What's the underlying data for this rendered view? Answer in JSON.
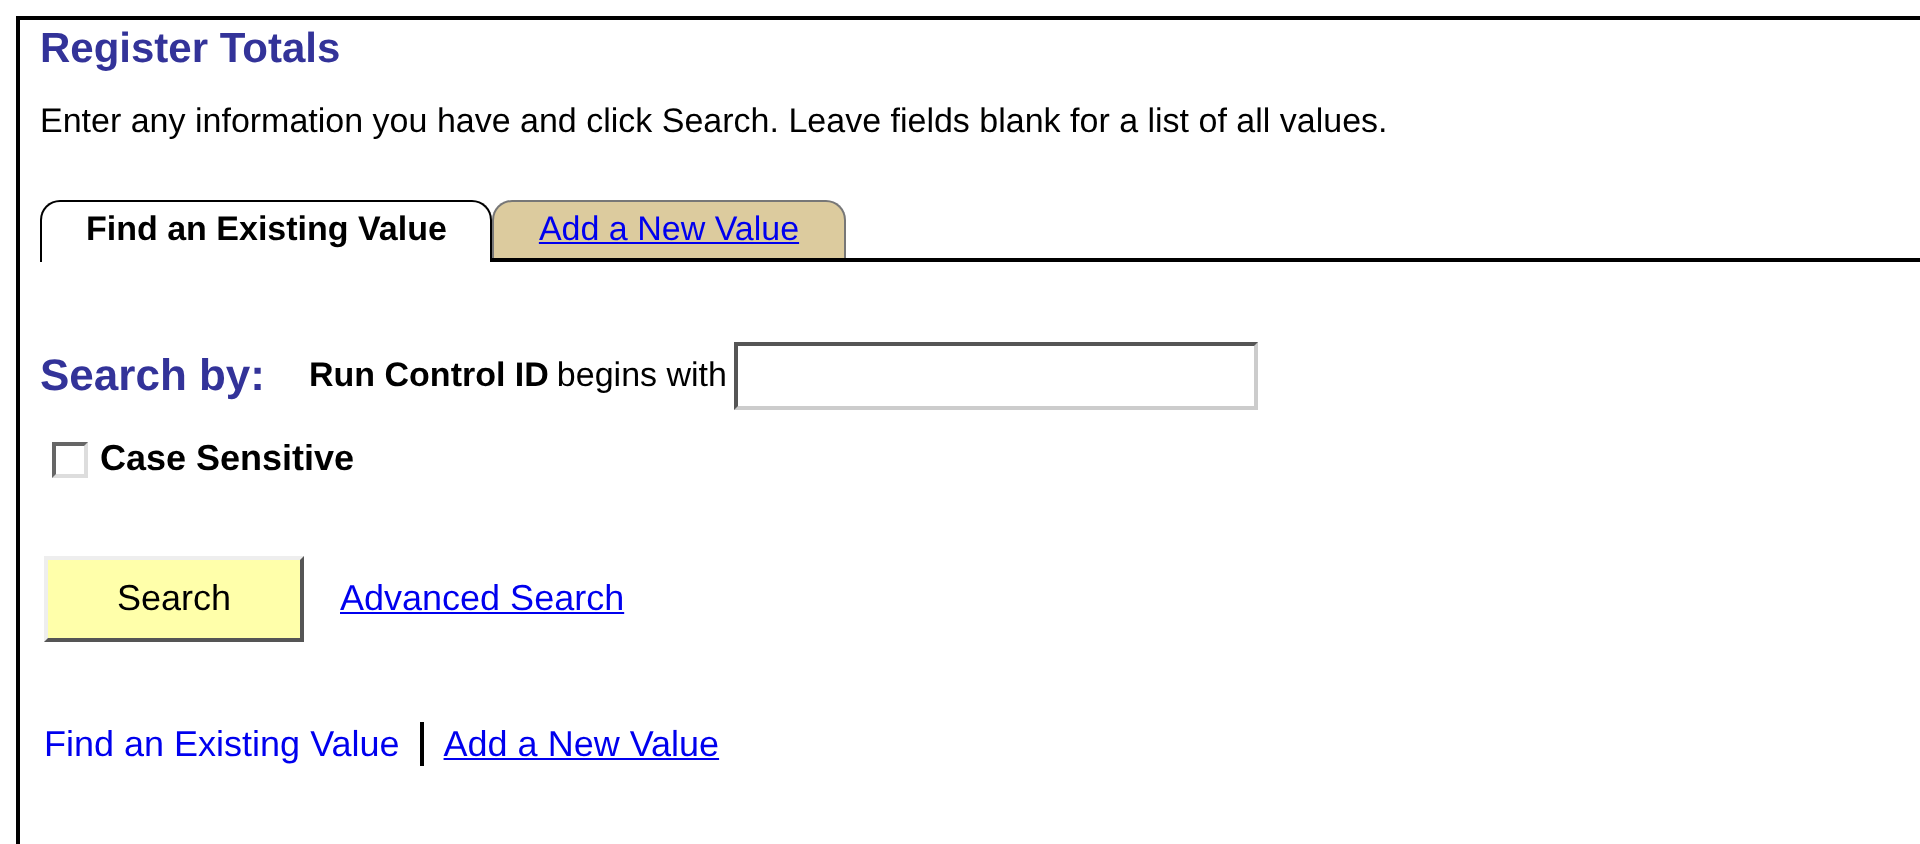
{
  "page": {
    "title": "Register Totals",
    "instructions": "Enter any information you have and click Search. Leave fields blank for a list of all values."
  },
  "tabs": [
    {
      "label": "Find an Existing Value",
      "selected": true
    },
    {
      "label": "Add a New Value",
      "selected": false
    }
  ],
  "search": {
    "label": "Search by:",
    "field_label": "Run Control ID",
    "operator": "begins with"
  },
  "case_sensitive": {
    "label": "Case Sensitive",
    "checked": false
  },
  "actions": {
    "search_button": "Search",
    "advanced_link": "Advanced Search"
  },
  "footer_links": [
    {
      "label": "Find an Existing Value",
      "selected": true
    },
    {
      "label": "Add a New Value",
      "selected": false
    }
  ]
}
